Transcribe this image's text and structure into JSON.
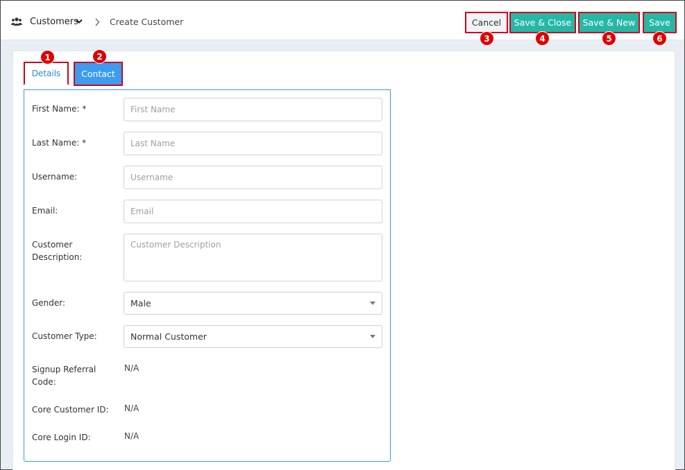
{
  "breadcrumb": {
    "root_label": "Customers",
    "current_label": "Create Customer"
  },
  "actions": {
    "cancel_label": "Cancel",
    "save_close_label": "Save & Close",
    "save_new_label": "Save & New",
    "save_label": "Save"
  },
  "tabs": [
    {
      "label": "Details",
      "active": true
    },
    {
      "label": "Contact",
      "active": false
    }
  ],
  "markers": [
    "1",
    "2",
    "3",
    "4",
    "5",
    "6"
  ],
  "form": {
    "first_name": {
      "label": "First Name: *",
      "placeholder": "First Name"
    },
    "last_name": {
      "label": "Last Name: *",
      "placeholder": "Last Name"
    },
    "username": {
      "label": "Username:",
      "placeholder": "Username"
    },
    "email": {
      "label": "Email:",
      "placeholder": "Email"
    },
    "description": {
      "label_line1": "Customer",
      "label_line2": "Description:",
      "placeholder": "Customer Description"
    },
    "gender": {
      "label": "Gender:",
      "value": "Male"
    },
    "customer_type": {
      "label": "Customer Type:",
      "value": "Normal Customer"
    },
    "signup_referral": {
      "label_line1": "Signup Referral",
      "label_line2": "Code:",
      "value": "N/A"
    },
    "core_customer_id": {
      "label": "Core Customer ID:",
      "value": "N/A"
    },
    "core_login_id": {
      "label": "Core Login ID:",
      "value": "N/A"
    }
  },
  "colors": {
    "primary_teal": "#26b8a6",
    "tab_blue": "#3c9cf0",
    "highlight_red": "#d0021b",
    "marker_red": "#e00000"
  },
  "icons": [
    "users-icon",
    "chevron-down-icon",
    "chevron-right-icon",
    "caret-down-icon"
  ]
}
